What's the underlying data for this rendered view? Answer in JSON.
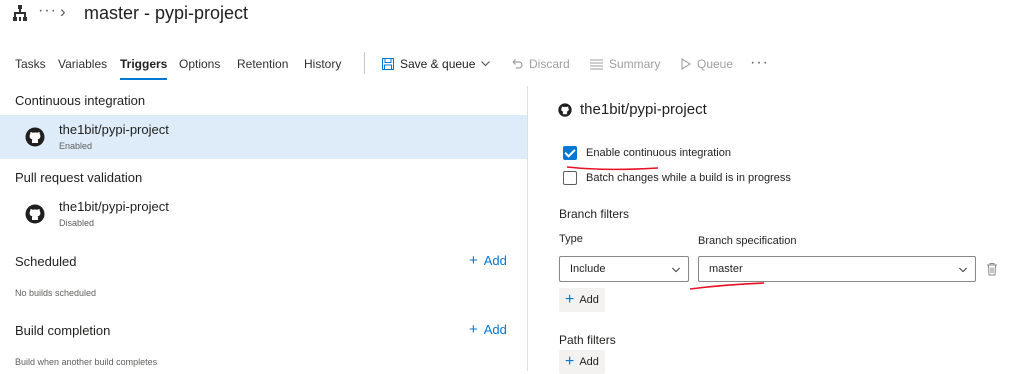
{
  "header": {
    "breadcrumb_more": "···",
    "breadcrumb_sep": "›",
    "title": "master - pypi-project"
  },
  "tabs": [
    {
      "label": "Tasks",
      "active": false
    },
    {
      "label": "Variables",
      "active": false
    },
    {
      "label": "Triggers",
      "active": true
    },
    {
      "label": "Options",
      "active": false
    },
    {
      "label": "Retention",
      "active": false
    },
    {
      "label": "History",
      "active": false
    }
  ],
  "toolbar": {
    "save_queue": "Save & queue",
    "discard": "Discard",
    "summary": "Summary",
    "queue": "Queue",
    "more": "···"
  },
  "left": {
    "ci_title": "Continuous integration",
    "ci_repo": {
      "name": "the1bit/pypi-project",
      "status": "Enabled"
    },
    "pr_title": "Pull request validation",
    "pr_repo": {
      "name": "the1bit/pypi-project",
      "status": "Disabled"
    },
    "scheduled_title": "Scheduled",
    "scheduled_add": "Add",
    "scheduled_empty": "No builds scheduled",
    "build_completion_title": "Build completion",
    "build_completion_add": "Add",
    "build_completion_empty": "Build when another build completes"
  },
  "right": {
    "repo_title": "the1bit/pypi-project",
    "enable_ci_label": "Enable continuous integration",
    "enable_ci_checked": true,
    "batch_label": "Batch changes while a build is in progress",
    "batch_checked": false,
    "branch_filters_title": "Branch filters",
    "type_label": "Type",
    "type_value": "Include",
    "branch_spec_label": "Branch specification",
    "branch_spec_value": "master",
    "branch_add": "Add",
    "path_filters_title": "Path filters",
    "path_add": "Add"
  },
  "colors": {
    "accent": "#0078d4",
    "selected_row": "#deecf9",
    "annotation": "#e81123"
  }
}
